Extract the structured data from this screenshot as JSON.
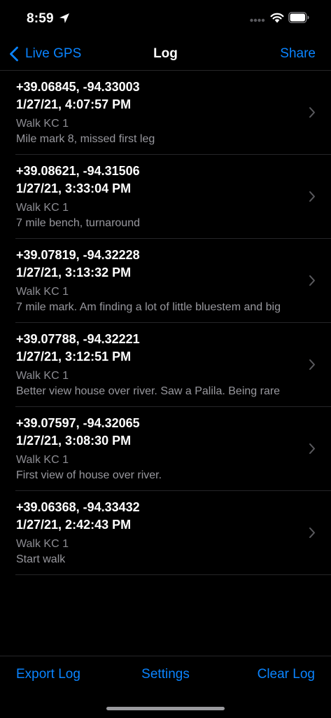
{
  "status_bar": {
    "time": "8:59",
    "icons": [
      "location-arrow-icon",
      "cellular-dots-icon",
      "wifi-icon",
      "battery-icon"
    ]
  },
  "nav": {
    "back_label": "Live GPS",
    "title": "Log",
    "share_label": "Share"
  },
  "log_entries": [
    {
      "coords": "+39.06845, -94.33003",
      "time": "1/27/21, 4:07:57 PM",
      "trip": "Walk KC 1",
      "note": "Mile mark 8, missed first leg"
    },
    {
      "coords": "+39.08621, -94.31506",
      "time": "1/27/21, 3:33:04 PM",
      "trip": "Walk KC 1",
      "note": "7 mile bench, turnaround"
    },
    {
      "coords": "+39.07819, -94.32228",
      "time": "1/27/21, 3:13:32 PM",
      "trip": "Walk KC 1",
      "note": "7 mile mark. Am finding a lot of little bluestem and big"
    },
    {
      "coords": "+39.07788, -94.32221",
      "time": "1/27/21, 3:12:51 PM",
      "trip": "Walk KC 1",
      "note": "Better view house over river. Saw a Palila. Being rare"
    },
    {
      "coords": "+39.07597, -94.32065",
      "time": "1/27/21, 3:08:30 PM",
      "trip": "Walk KC 1",
      "note": "First view of house over river."
    },
    {
      "coords": "+39.06368, -94.33432",
      "time": "1/27/21, 2:42:43 PM",
      "trip": "Walk KC 1",
      "note": "Start walk"
    }
  ],
  "toolbar": {
    "export_label": "Export Log",
    "settings_label": "Settings",
    "clear_label": "Clear Log"
  },
  "colors": {
    "accent": "#0a84ff",
    "background": "#000000",
    "secondary_text": "#8d8d93",
    "separator": "#262628"
  }
}
